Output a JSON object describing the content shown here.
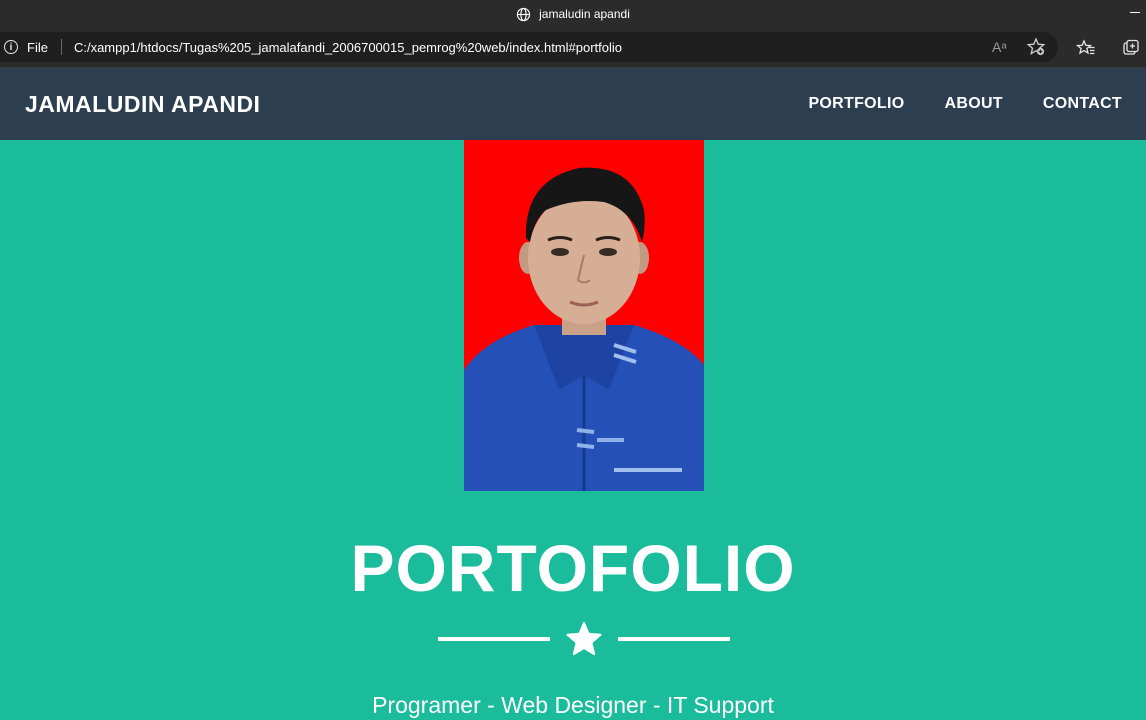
{
  "browser": {
    "tab_title": "jamaludin apandi",
    "file_label": "File",
    "url": "C:/xampp1/htdocs/Tugas%205_jamalafandi_2006700015_pemrog%20web/index.html#portfolio",
    "read_aloud_label": "Aᵃ"
  },
  "navbar": {
    "brand": "JAMALUDIN APANDI",
    "links": [
      "PORTFOLIO",
      "ABOUT",
      "CONTACT"
    ]
  },
  "hero": {
    "title": "PORTOFOLIO",
    "subtitle": "Programer - Web Designer - IT Support"
  },
  "colors": {
    "page_bg": "#1abc9c",
    "navbar_bg": "#2c3e50",
    "photo_bg": "#ff0000",
    "shirt": "#2450b8"
  }
}
